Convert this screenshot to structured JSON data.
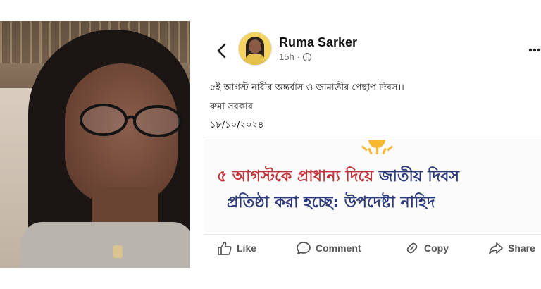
{
  "photo": {
    "subject_icon": "portrait-photo"
  },
  "post": {
    "author": "Ruma Sarker",
    "time": "15h",
    "separator": "·",
    "lines": [
      "৫ই আগস্ট নারীর অন্তর্বাস ও জামাতীর পেছাপ দিবস।।",
      "রুমা সরকার",
      "১৮/১০/২০২৪"
    ],
    "embed": {
      "line1_red": "৫ আগস্টকে প্রাধান্য দিয়ে",
      "line1_blue": " জাতীয় দিবস",
      "line2": "প্রতিষ্ঠা করা হচ্ছে: উপদেষ্টা নাহিদ"
    },
    "actions": {
      "like": "Like",
      "comment": "Comment",
      "copy": "Copy",
      "share": "Share"
    }
  },
  "colors": {
    "headline_red": "#c0343b",
    "headline_blue": "#2d3a78",
    "sun": "#f5b82e"
  }
}
